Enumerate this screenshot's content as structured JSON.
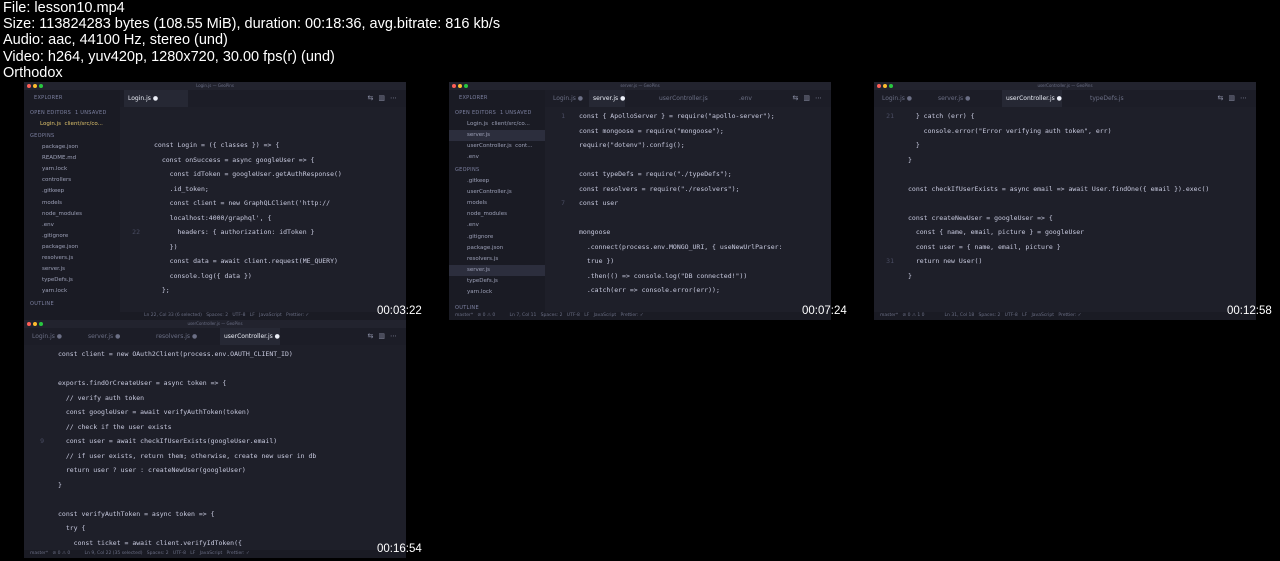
{
  "header": {
    "file_line": "File: lesson10.mp4",
    "size_line": "Size: 113824283 bytes (108.55 MiB), duration: 00:18:36, avg.bitrate: 816 kb/s",
    "audio_line": "Audio: aac, 44100 Hz, stereo (und)",
    "video_line": "Video: h264, yuv420p, 1280x720, 30.00 fps(r) (und)",
    "author_line": "Orthodox"
  },
  "thumb1": {
    "timestamp": "00:03:22",
    "window_title": "Login.js — GeoPins",
    "tabs": {
      "active": "Login.js"
    },
    "sidebar": {
      "explorer": "EXPLORER",
      "open_editors": "OPEN EDITORS  1 UNSAVED",
      "open_file": "Login.js  client/src/co...",
      "project": "GEOPINS",
      "items": [
        "package.json",
        "README.md",
        "yarn.lock",
        "controllers",
        ".gitkeep",
        "models",
        "node_modules",
        ".env",
        ".gitignore",
        "package.json",
        "resolvers.js",
        "server.js",
        "typeDefs.js",
        "yarn.lock"
      ],
      "outline": "OUTLINE"
    },
    "code": [
      {
        "n": "",
        "t": ""
      },
      {
        "n": "",
        "t": ""
      },
      {
        "n": "",
        "t": "const Login = ({ classes }) => {"
      },
      {
        "n": "",
        "t": "  const onSuccess = async googleUser => {"
      },
      {
        "n": "",
        "t": "    const idToken = googleUser.getAuthResponse()"
      },
      {
        "n": "",
        "t": "    .id_token;"
      },
      {
        "n": "",
        "t": "    const client = new GraphQLClient('http://"
      },
      {
        "n": "",
        "t": "    localhost:4000/graphql', {"
      },
      {
        "n": "22",
        "t": "      headers: { authorization: idToken }"
      },
      {
        "n": "",
        "t": "    })"
      },
      {
        "n": "",
        "t": "    const data = await client.request(ME_QUERY)"
      },
      {
        "n": "",
        "t": "    console.log({ data })"
      },
      {
        "n": "",
        "t": "  };"
      }
    ],
    "status": "Ln 22, Col 33 (6 selected)   Spaces: 2   UTF-8   LF   JavaScript   Prettier: ✓"
  },
  "thumb2": {
    "timestamp": "00:07:24",
    "window_title": "server.js — GeoPins",
    "tabs": {
      "t1": "Login.js",
      "t2": "server.js",
      "t3": "userController.js",
      "t4": ".env"
    },
    "sidebar": {
      "explorer": "EXPLORER",
      "open_editors": "OPEN EDITORS  1 UNSAVED",
      "open_files": [
        "Login.js  client/src/co...",
        "server.js",
        "userController.js  cont...",
        ".env"
      ],
      "project": "GEOPINS",
      "items": [
        ".gitkeep",
        "userController.js",
        "models",
        "node_modules",
        ".env",
        ".gitignore",
        "package.json",
        "resolvers.js",
        "server.js",
        "typeDefs.js",
        "yarn.lock"
      ],
      "outline": "OUTLINE"
    },
    "code": [
      {
        "n": "1",
        "t": "const { ApolloServer } = require(\"apollo-server\");"
      },
      {
        "n": "",
        "t": "const mongoose = require(\"mongoose\");"
      },
      {
        "n": "",
        "t": "require(\"dotenv\").config();"
      },
      {
        "n": "",
        "t": ""
      },
      {
        "n": "",
        "t": "const typeDefs = require(\"./typeDefs\");"
      },
      {
        "n": "",
        "t": "const resolvers = require(\"./resolvers\");"
      },
      {
        "n": "7",
        "t": "const user"
      },
      {
        "n": "",
        "t": ""
      },
      {
        "n": "",
        "t": "mongoose"
      },
      {
        "n": "",
        "t": "  .connect(process.env.MONGO_URI, { useNewUrlParser:"
      },
      {
        "n": "",
        "t": "  true })"
      },
      {
        "n": "",
        "t": "  .then(() => console.log(\"DB connected!\"))"
      },
      {
        "n": "",
        "t": "  .catch(err => console.error(err));"
      }
    ],
    "status": "master*   ⊘ 0 ⚠ 0          Ln 7, Col 11   Spaces: 2   UTF-8   LF   JavaScript   Prettier: ✓"
  },
  "thumb3": {
    "timestamp": "00:12:58",
    "window_title": "userController.js — GeoPins",
    "tabs": {
      "t1": "Login.js",
      "t2": "server.js",
      "t3": "userController.js",
      "t4": "typeDefs.js"
    },
    "code": [
      {
        "n": "21",
        "t": "  } catch (err) {"
      },
      {
        "n": "",
        "t": "    console.error(\"Error verifying auth token\", err)"
      },
      {
        "n": "",
        "t": "  }"
      },
      {
        "n": "",
        "t": "}"
      },
      {
        "n": "",
        "t": ""
      },
      {
        "n": "",
        "t": "const checkIfUserExists = async email => await User.findOne({ email }).exec()"
      },
      {
        "n": "",
        "t": ""
      },
      {
        "n": "",
        "t": "const createNewUser = googleUser => {"
      },
      {
        "n": "",
        "t": "  const { name, email, picture } = googleUser"
      },
      {
        "n": "",
        "t": "  const user = { name, email, picture }"
      },
      {
        "n": "31",
        "t": "  return new User()"
      },
      {
        "n": "",
        "t": "}"
      }
    ],
    "status": "master*   ⊘ 0 ⚠ 1 0              Ln 31, Col 18   Spaces: 2   UTF-8   LF   JavaScript   Prettier: ✓"
  },
  "thumb4": {
    "timestamp": "00:16:54",
    "window_title": "userController.js — GeoPins",
    "tabs": {
      "t1": "Login.js",
      "t2": "server.js",
      "t3": "resolvers.js",
      "t4": "userController.js"
    },
    "code": [
      {
        "n": "",
        "t": "const client = new OAuth2Client(process.env.OAUTH_CLIENT_ID)"
      },
      {
        "n": "",
        "t": ""
      },
      {
        "n": "",
        "t": "exports.findOrCreateUser = async token => {"
      },
      {
        "n": "",
        "t": "  // verify auth token"
      },
      {
        "n": "",
        "t": "  const googleUser = await verifyAuthToken(token)"
      },
      {
        "n": "",
        "t": "  // check if the user exists"
      },
      {
        "n": "9",
        "t": "  const user = await checkIfUserExists(googleUser.email)"
      },
      {
        "n": "",
        "t": "  // if user exists, return them; otherwise, create new user in db"
      },
      {
        "n": "",
        "t": "  return user ? user : createNewUser(googleUser)"
      },
      {
        "n": "",
        "t": "}"
      },
      {
        "n": "",
        "t": ""
      },
      {
        "n": "",
        "t": "const verifyAuthToken = async token => {"
      },
      {
        "n": "",
        "t": "  try {"
      },
      {
        "n": "",
        "t": "    const ticket = await client.verifyIdToken({"
      }
    ],
    "status": "master*   ⊘ 0 ⚠ 0          Ln 9, Col 22 (35 selected)   Spaces: 2   UTF-8   LF   JavaScript   Prettier: ✓"
  }
}
